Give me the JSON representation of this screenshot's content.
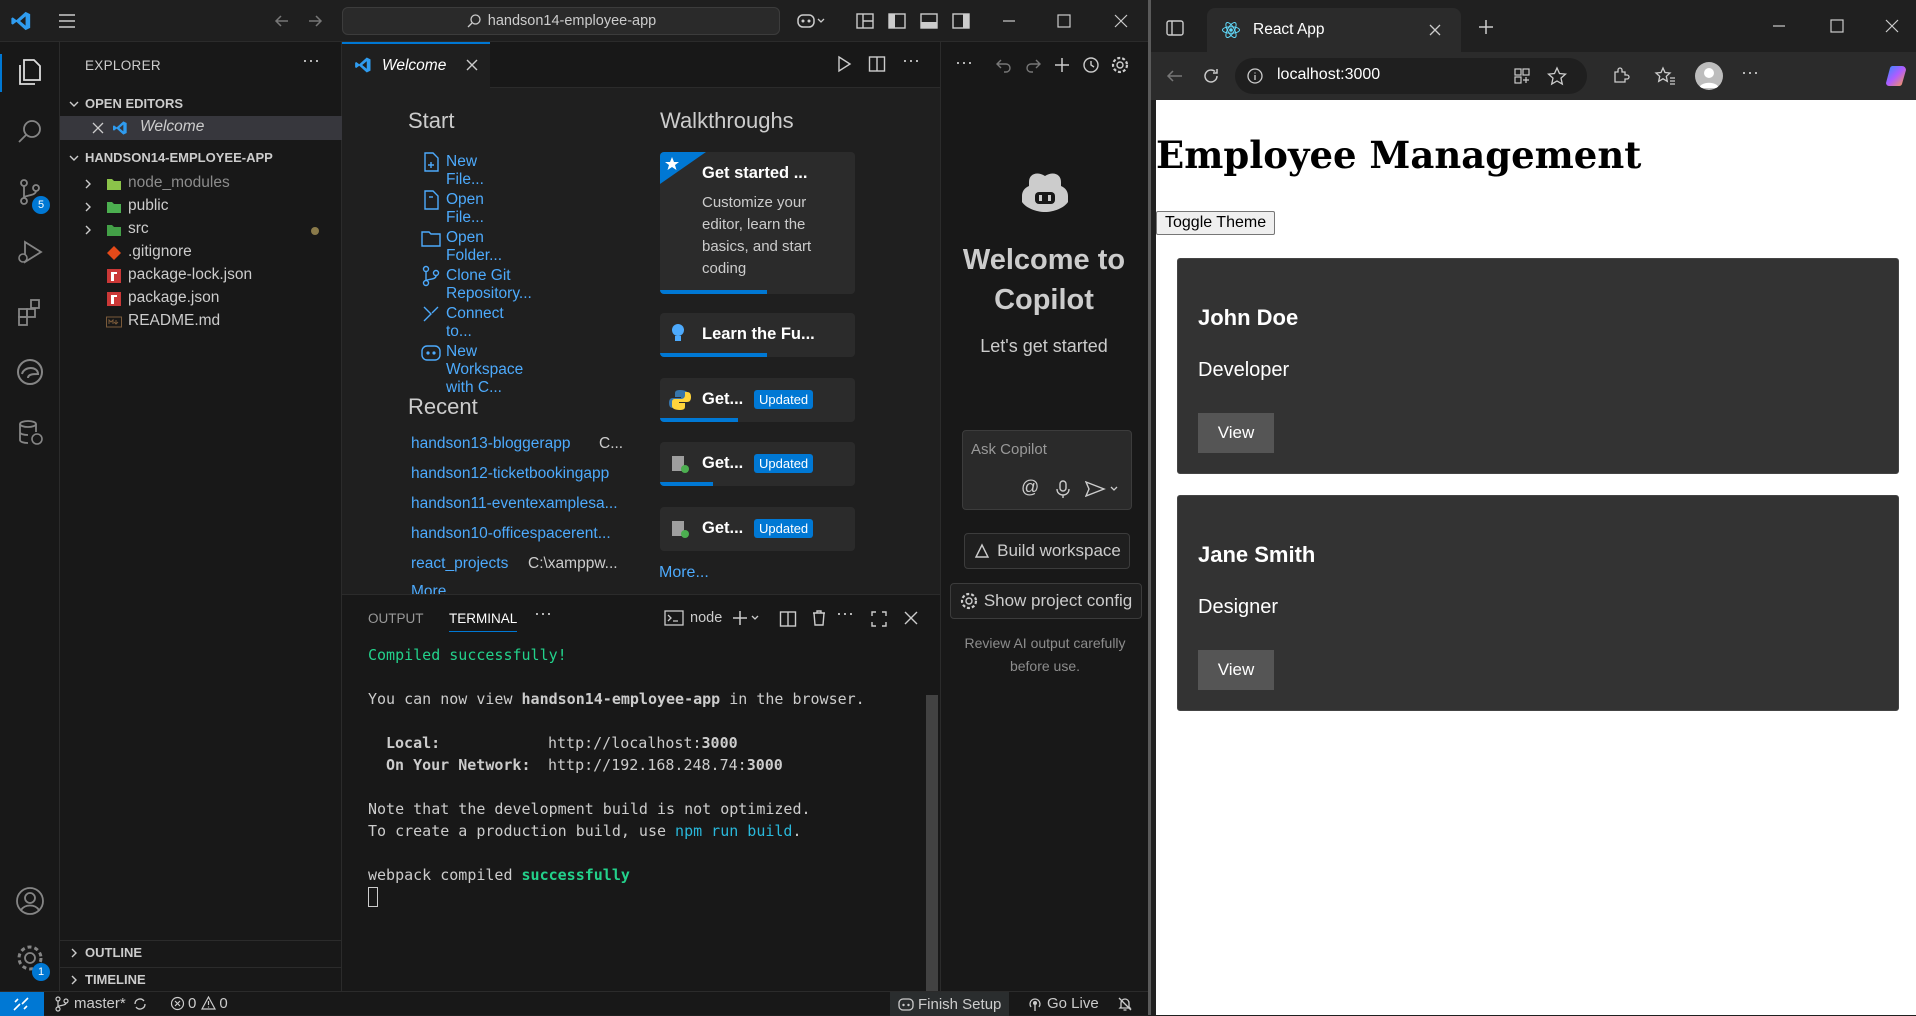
{
  "vscode": {
    "search_label": "handson14-employee-app",
    "explorer_title": "EXPLORER",
    "open_editors_title": "OPEN EDITORS",
    "open_editor_item": "Welcome",
    "project_title": "HANDSON14-EMPLOYEE-APP",
    "tree": [
      {
        "label": "node_modules",
        "type": "folder"
      },
      {
        "label": "public",
        "type": "folder"
      },
      {
        "label": "src",
        "type": "folder"
      },
      {
        "label": ".gitignore",
        "type": "file"
      },
      {
        "label": "package-lock.json",
        "type": "file"
      },
      {
        "label": "package.json",
        "type": "file"
      },
      {
        "label": "README.md",
        "type": "file"
      }
    ],
    "outline_title": "OUTLINE",
    "timeline_title": "TIMELINE",
    "source_control_badge": "5",
    "settings_badge": "1",
    "tab_label": "Welcome",
    "welcome": {
      "start_title": "Start",
      "start_links": [
        "New File...",
        "Open File...",
        "Open Folder...",
        "Clone Git Repository...",
        "Connect to...",
        "New Workspace with C..."
      ],
      "recent_title": "Recent",
      "recent": [
        {
          "name": "handson13-bloggerapp",
          "path": "C..."
        },
        {
          "name": "handson12-ticketbookingapp",
          "path": ""
        },
        {
          "name": "handson11-eventexamplesa...",
          "path": ""
        },
        {
          "name": "handson10-officespacerent...",
          "path": ""
        },
        {
          "name": "react_projects",
          "path": "C:\\xamppw..."
        }
      ],
      "recent_more": "More...",
      "walkthroughs_title": "Walkthroughs",
      "walk_main_title": "Get started ...",
      "walk_main_desc": "Customize your editor, learn the basics, and start coding",
      "walk_learn": "Learn the Fu...",
      "walk_get": "Get...",
      "updated": "Updated",
      "walk_more": "More...",
      "progress": [
        0.55,
        0.55,
        0.4,
        0.27,
        0
      ]
    },
    "panel": {
      "tab_output": "OUTPUT",
      "tab_terminal": "TERMINAL",
      "terminal_name": "node",
      "lines": {
        "compiled": "Compiled successfully!",
        "view_pre": "You can now view ",
        "view_app": "handson14-employee-app",
        "view_post": " in the browser.",
        "local_label": "Local:",
        "local_url_pre": "http://localhost:",
        "local_port": "3000",
        "net_label": "On Your Network:",
        "net_url_pre": "http://192.168.248.74:",
        "net_port": "3000",
        "note1": "Note that the development build is not optimized.",
        "note2_pre": "To create a production build, use ",
        "note2_cmd": "npm run build",
        "note2_post": ".",
        "webpack_pre": "webpack compiled ",
        "webpack_ok": "successfully"
      }
    },
    "copilot": {
      "welcome_title": "Welcome to Copilot",
      "subtitle": "Let's get started",
      "ask_placeholder": "Ask Copilot",
      "build_workspace": "Build workspace",
      "show_config": "Show project config",
      "disclaimer": "Review AI output carefully before use."
    },
    "status": {
      "branch": "master*",
      "errors": "0",
      "warnings": "0",
      "finish_setup": "Finish Setup",
      "go_live": "Go Live"
    }
  },
  "browser": {
    "tab_title": "React App",
    "url": "localhost:3000",
    "page": {
      "heading": "Employee Management",
      "toggle_button": "Toggle Theme",
      "employees": [
        {
          "name": "John Doe",
          "role": "Developer",
          "button": "View"
        },
        {
          "name": "Jane Smith",
          "role": "Designer",
          "button": "View"
        }
      ]
    }
  }
}
